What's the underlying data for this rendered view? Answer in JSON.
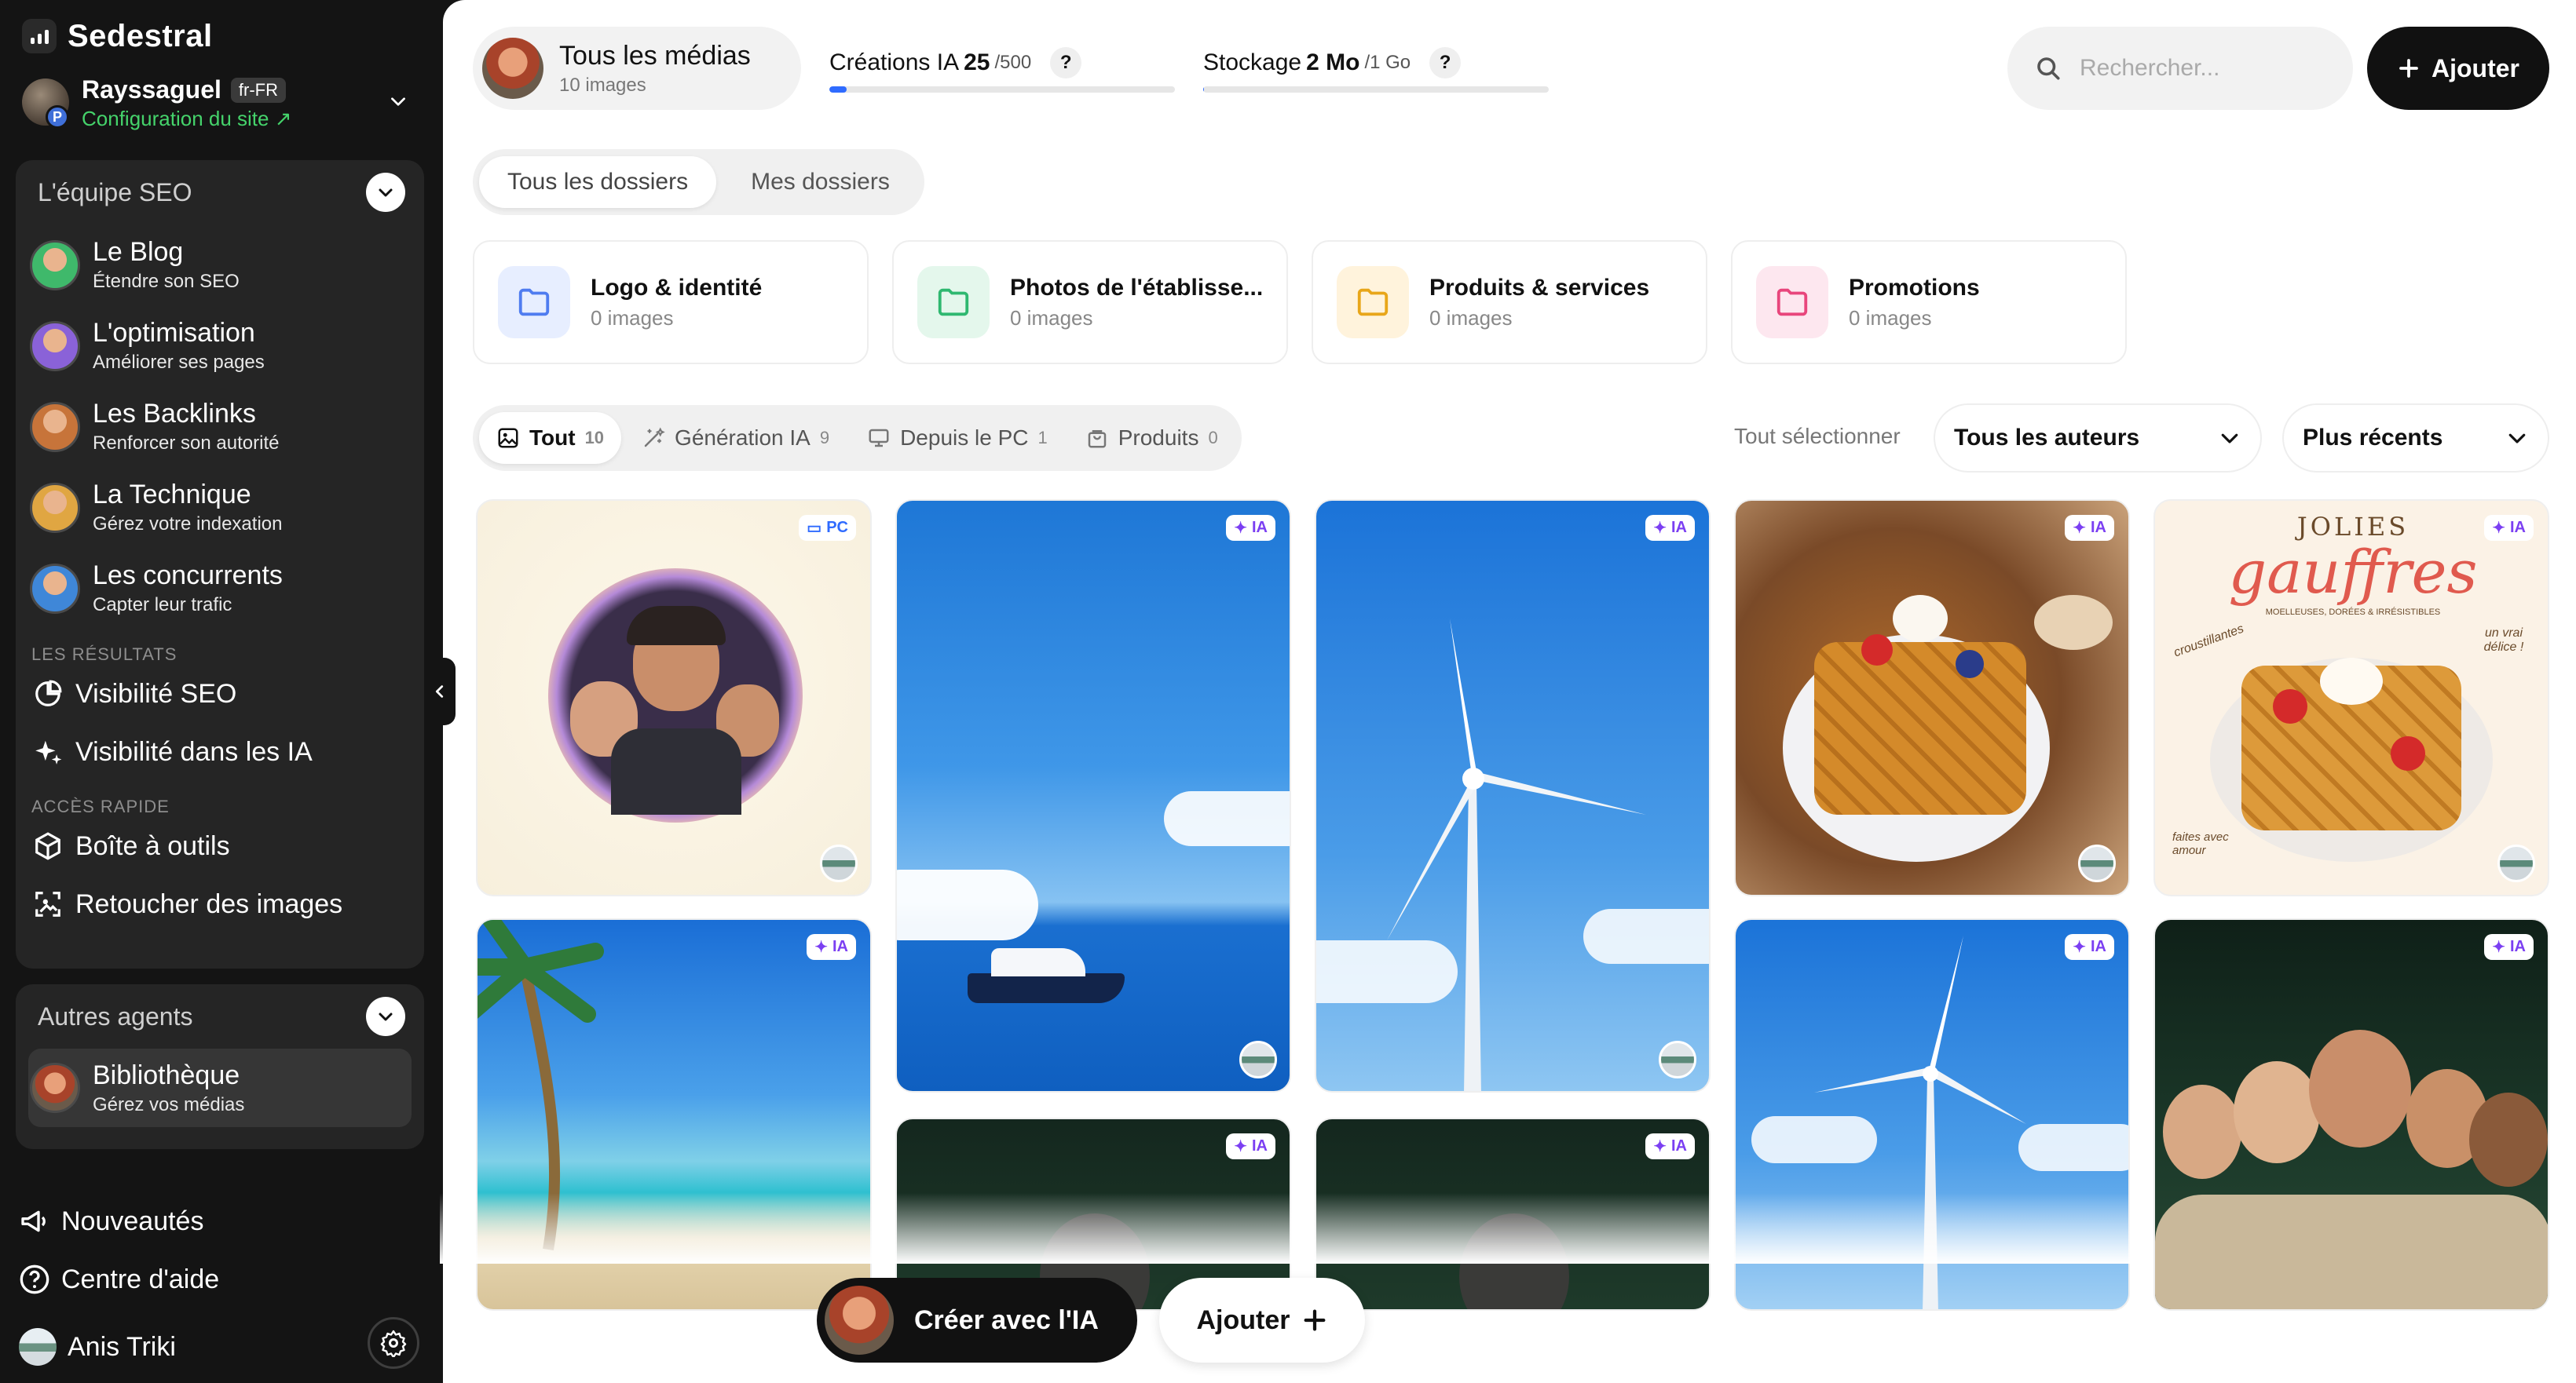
{
  "app": {
    "name": "Sedestral"
  },
  "site": {
    "name": "Rayssaguel",
    "locale": "fr-FR",
    "config_link": "Configuration du site",
    "badge_letter": "P"
  },
  "team_panel": {
    "title": "L'équipe SEO",
    "agents": [
      {
        "title": "Le Blog",
        "subtitle": "Étendre son SEO",
        "color": "#3fb96b"
      },
      {
        "title": "L'optimisation",
        "subtitle": "Améliorer ses pages",
        "color": "#8a62d8"
      },
      {
        "title": "Les Backlinks",
        "subtitle": "Renforcer son autorité",
        "color": "#c7743a"
      },
      {
        "title": "La Technique",
        "subtitle": "Gérez votre indexation",
        "color": "#e0a642"
      },
      {
        "title": "Les concurrents",
        "subtitle": "Capter leur trafic",
        "color": "#3f87d8"
      }
    ],
    "results_label": "LES RÉSULTATS",
    "results": [
      {
        "label": "Visibilité SEO",
        "icon": "pie-chart-icon"
      },
      {
        "label": "Visibilité dans les IA",
        "icon": "sparkles-icon"
      }
    ],
    "quick_label": "ACCÈS RAPIDE",
    "quick": [
      {
        "label": "Boîte à outils",
        "icon": "toolbox-icon"
      },
      {
        "label": "Retoucher des images",
        "icon": "image-edit-icon"
      }
    ]
  },
  "other_panel": {
    "title": "Autres agents",
    "agent": {
      "title": "Bibliothèque",
      "subtitle": "Gérez vos médias"
    }
  },
  "bottom_nav": {
    "news": "Nouveautés",
    "help": "Centre d'aide",
    "user": "Anis Triki"
  },
  "header": {
    "media_title": "Tous les médias",
    "media_count": "10 images",
    "ai_label": "Créations IA",
    "ai_used": "25",
    "ai_total": "/500",
    "ai_progress": 0.05,
    "storage_label": "Stockage",
    "storage_used": "2 Mo",
    "storage_total": "/1 Go",
    "storage_progress": 0.002,
    "help_glyph": "?",
    "search_placeholder": "Rechercher...",
    "add_label": "Ajouter"
  },
  "folder_tabs": [
    {
      "label": "Tous les dossiers",
      "active": true
    },
    {
      "label": "Mes dossiers",
      "active": false
    }
  ],
  "folders": [
    {
      "name": "Logo & identité",
      "count": "0 images",
      "color": "#4f7cf0",
      "bg": "#e7eeff"
    },
    {
      "name": "Photos de l'établisse...",
      "count": "0 images",
      "color": "#2fb870",
      "bg": "#e4f7ec"
    },
    {
      "name": "Produits & services",
      "count": "0 images",
      "color": "#e8a61a",
      "bg": "#fff3dc"
    },
    {
      "name": "Promotions",
      "count": "0 images",
      "color": "#e8467c",
      "bg": "#fde7ef"
    }
  ],
  "filters": [
    {
      "label": "Tout",
      "count": "10",
      "icon": "image-icon",
      "active": true
    },
    {
      "label": "Génération IA",
      "count": "9",
      "icon": "magic-wand-icon",
      "active": false
    },
    {
      "label": "Depuis le PC",
      "count": "1",
      "icon": "monitor-icon",
      "active": false
    },
    {
      "label": "Produits",
      "count": "0",
      "icon": "shopping-bag-icon",
      "active": false
    }
  ],
  "select_all": "Tout sélectionner",
  "authors_dropdown": "Tous les auteurs",
  "sort_dropdown": "Plus récents",
  "badges": {
    "pc": "PC",
    "ia": "IA"
  },
  "waffle_card": {
    "line1": "JOLIES",
    "line2": "gauffres",
    "tagline": "MOELLEUSES, DORÉES & IRRÉSISTIBLES",
    "left_note": "croustillantes",
    "right_note": "un vrai délice !",
    "bottom_note": "faites avec amour"
  },
  "bottom_actions": {
    "create_ai": "Créer avec l'IA",
    "add": "Ajouter"
  }
}
